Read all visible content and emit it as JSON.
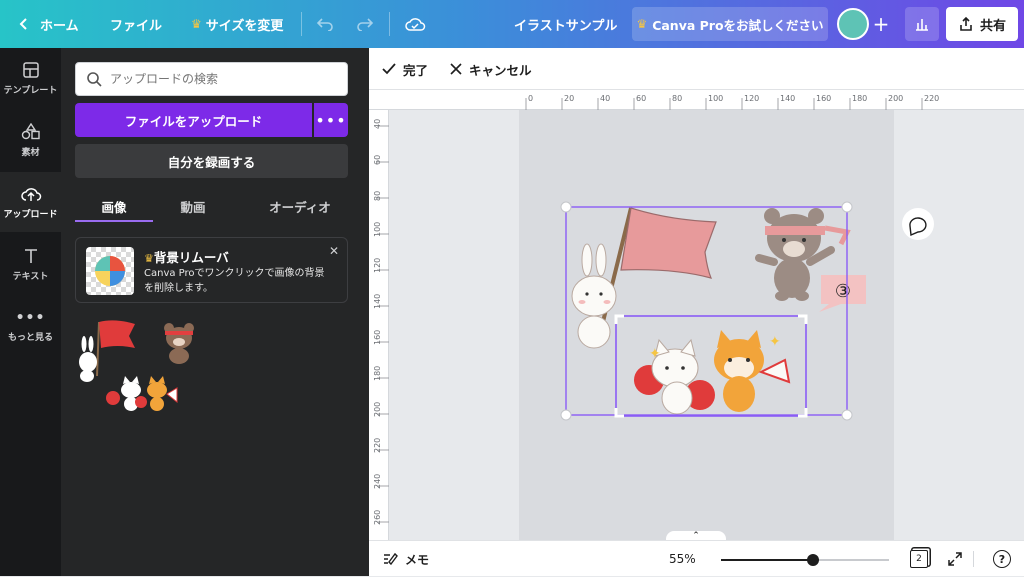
{
  "topbar": {
    "back_label": "ホーム",
    "file_label": "ファイル",
    "resize_label": "サイズを変更",
    "title": "イラストサンプル",
    "pro_label": "Canva Proをお試しください",
    "share_label": "共有"
  },
  "rail": {
    "items": [
      {
        "label": "テンプレート",
        "icon": "template-icon"
      },
      {
        "label": "素材",
        "icon": "elements-icon"
      },
      {
        "label": "アップロード",
        "icon": "upload-cloud-icon"
      },
      {
        "label": "テキスト",
        "icon": "text-icon"
      },
      {
        "label": "もっと見る",
        "icon": "more-dots-icon"
      }
    ],
    "active": "アップロード"
  },
  "panel": {
    "search_placeholder": "アップロードの検索",
    "upload_label": "ファイルをアップロード",
    "more_label": "•••",
    "record_label": "自分を録画する",
    "tabs": [
      "画像",
      "動画",
      "オーディオ"
    ],
    "active_tab": "画像",
    "promo": {
      "title": "背景リムーバ",
      "desc": "Canva Proでワンクリックで画像の背景を削除します。"
    }
  },
  "toolbar": {
    "done_label": "完了",
    "cancel_label": "キャンセル"
  },
  "ruler": {
    "top_ticks": [
      "0",
      "20",
      "40",
      "60",
      "80",
      "100",
      "120",
      "140",
      "160",
      "180",
      "200",
      "220"
    ],
    "left_ticks": [
      "40",
      "60",
      "80",
      "100",
      "120",
      "140",
      "160",
      "180",
      "200",
      "220",
      "240",
      "260"
    ]
  },
  "canvas": {
    "annotation": "③"
  },
  "bottombar": {
    "notes_label": "メモ",
    "zoom_label": "55%",
    "zoom_level": 0.55,
    "page_count": "2",
    "help_label": "?"
  },
  "colors": {
    "accent": "#7d2ae8",
    "selection": "#8b5cf6"
  }
}
